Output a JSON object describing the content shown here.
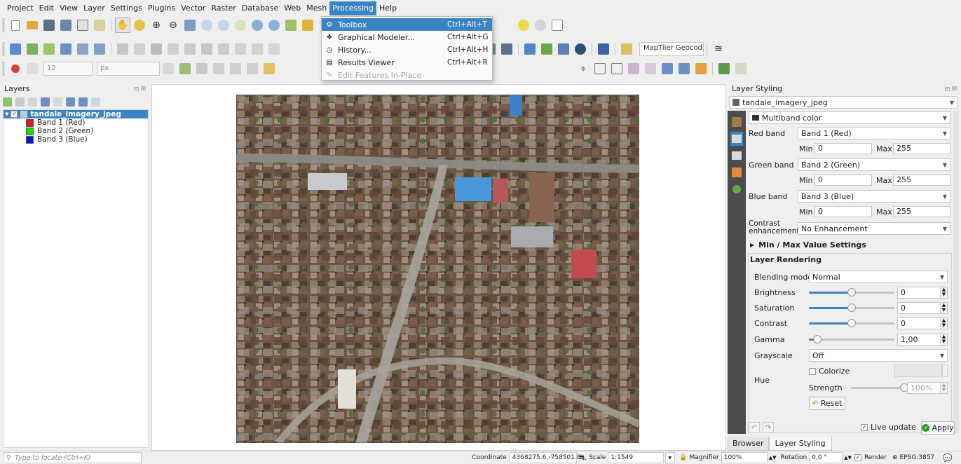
{
  "menubar": {
    "items": [
      "Project",
      "Edit",
      "View",
      "Layer",
      "Settings",
      "Plugins",
      "Vector",
      "Raster",
      "Database",
      "Web",
      "Mesh",
      "Processing",
      "Help"
    ],
    "active": "Processing"
  },
  "processing_menu": {
    "items": [
      {
        "label": "Toolbox",
        "shortcut": "Ctrl+Alt+T",
        "icon": "gear-icon",
        "state": "highlighted"
      },
      {
        "label": "Graphical Modeler...",
        "shortcut": "Ctrl+Alt+G",
        "icon": "model-icon",
        "state": "normal"
      },
      {
        "label": "History...",
        "shortcut": "Ctrl+Alt+H",
        "icon": "history-icon",
        "state": "normal"
      },
      {
        "label": "Results Viewer",
        "shortcut": "Ctrl+Alt+R",
        "icon": "results-icon",
        "state": "normal"
      },
      {
        "label": "Edit Features In-Place",
        "shortcut": "",
        "icon": "edit-inplace-icon",
        "state": "disabled"
      }
    ]
  },
  "toolbar": {
    "locator_placeholder": "MapTiler Geocodi...",
    "font_size": "12",
    "unit": "px"
  },
  "layers_panel": {
    "title": "Layers",
    "layer_name": "tandale_imagery_jpeg",
    "bands": [
      {
        "label": "Band 1 (Red)",
        "color": "#e81010"
      },
      {
        "label": "Band 2 (Green)",
        "color": "#10e010"
      },
      {
        "label": "Band 3 (Blue)",
        "color": "#1010d0"
      }
    ]
  },
  "styling": {
    "title": "Layer Styling",
    "layer": "tandale_imagery_jpeg",
    "renderer": "Multiband color",
    "red_band_label": "Red band",
    "red_band": "Band 1 (Red)",
    "green_band_label": "Green band",
    "green_band": "Band 2 (Green)",
    "blue_band_label": "Blue band",
    "blue_band": "Band 3 (Blue)",
    "min_label": "Min",
    "max_label": "Max",
    "min_value": "0",
    "max_value": "255",
    "contrast_label": "Contrast enhancement",
    "contrast_value": "No Enhancement",
    "minmax_section": "Min / Max Value Settings",
    "rendering_section": "Layer Rendering",
    "blending_label": "Blending mode",
    "blending_value": "Normal",
    "brightness_label": "Brightness",
    "brightness_value": "0",
    "saturation_label": "Saturation",
    "saturation_value": "0",
    "contrast2_label": "Contrast",
    "contrast2_value": "0",
    "gamma_label": "Gamma",
    "gamma_value": "1,00",
    "grayscale_label": "Grayscale",
    "grayscale_value": "Off",
    "hue_label": "Hue",
    "colorize_label": "Colorize",
    "strength_label": "Strength",
    "strength_value": "100%",
    "reset_label": "Reset",
    "live_update_label": "Live update",
    "apply_label": "Apply",
    "tabs": [
      "Browser",
      "Layer Styling"
    ],
    "active_tab": "Layer Styling"
  },
  "slider_levels": {
    "brightness": 0.5,
    "saturation": 0.5,
    "contrast": 0.5,
    "gamma": 0.1,
    "strength": 1.0
  },
  "statusbar": {
    "locator_placeholder": "Type to locate (Ctrl+K)",
    "coordinate_label": "Coordinate",
    "coordinate_value": "4368275.6,-758501.8",
    "scale_label": "Scale",
    "scale_value": "1:1549",
    "magnifier_label": "Magnifier",
    "magnifier_value": "100%",
    "rotation_label": "Rotation",
    "rotation_value": "0,0 °",
    "render_label": "Render",
    "crs_value": "EPSG:3857"
  }
}
